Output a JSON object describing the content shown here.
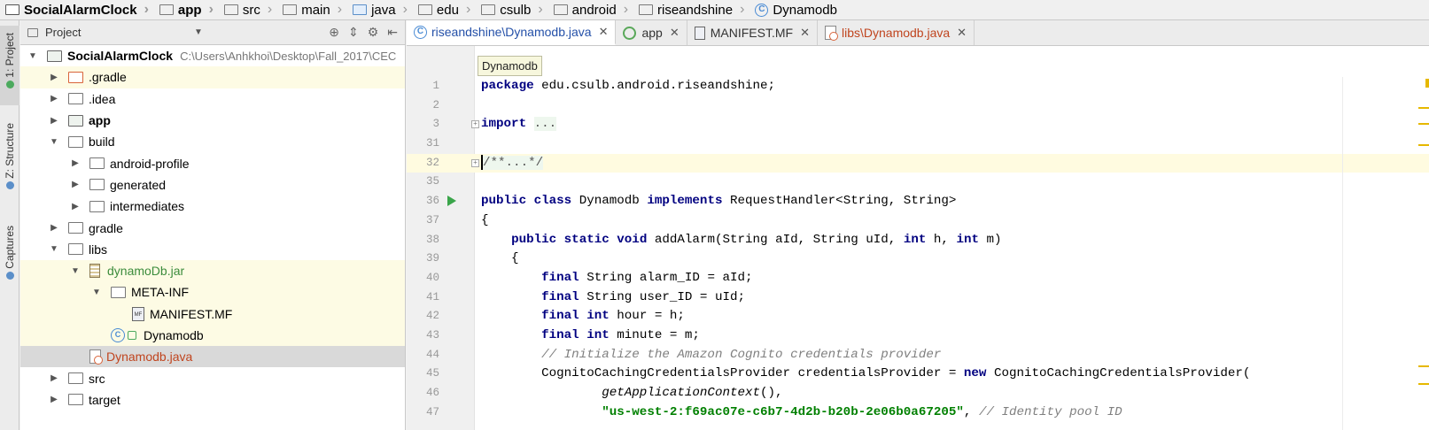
{
  "breadcrumb": [
    {
      "label": "SocialAlarmClock",
      "icon": "project-folder-icon",
      "bold": true
    },
    {
      "label": "app",
      "icon": "module-folder-icon",
      "bold": true
    },
    {
      "label": "src",
      "icon": "folder-icon"
    },
    {
      "label": "main",
      "icon": "folder-icon"
    },
    {
      "label": "java",
      "icon": "source-folder-icon"
    },
    {
      "label": "edu",
      "icon": "package-icon"
    },
    {
      "label": "csulb",
      "icon": "package-icon"
    },
    {
      "label": "android",
      "icon": "package-icon"
    },
    {
      "label": "riseandshine",
      "icon": "package-icon"
    },
    {
      "label": "Dynamodb",
      "icon": "class-icon"
    }
  ],
  "tool_strip": {
    "project": "1: Project",
    "structure": "Z: Structure",
    "captures": "Captures"
  },
  "project_panel": {
    "title": "Project",
    "tree": [
      {
        "label": "SocialAlarmClock",
        "path": "C:\\Users\\Anhkhoi\\Desktop\\Fall_2017\\CEC",
        "depth": 0,
        "state": "open",
        "icon": "project-folder-icon",
        "style": "bold"
      },
      {
        "label": ".gradle",
        "depth": 1,
        "state": "closed",
        "icon": "excluded-folder-icon",
        "highlight": true
      },
      {
        "label": ".idea",
        "depth": 1,
        "state": "closed",
        "icon": "folder-icon"
      },
      {
        "label": "app",
        "depth": 1,
        "state": "closed",
        "icon": "module-folder-icon",
        "style": "bold"
      },
      {
        "label": "build",
        "depth": 1,
        "state": "open",
        "icon": "folder-icon"
      },
      {
        "label": "android-profile",
        "depth": 2,
        "state": "closed",
        "icon": "folder-icon"
      },
      {
        "label": "generated",
        "depth": 2,
        "state": "closed",
        "icon": "folder-icon"
      },
      {
        "label": "intermediates",
        "depth": 2,
        "state": "closed",
        "icon": "folder-icon"
      },
      {
        "label": "gradle",
        "depth": 1,
        "state": "closed",
        "icon": "folder-icon"
      },
      {
        "label": "libs",
        "depth": 1,
        "state": "open",
        "icon": "folder-icon"
      },
      {
        "label": "dynamoDb.jar",
        "depth": 2,
        "state": "open",
        "icon": "jar-icon",
        "style": "green",
        "highlight": true
      },
      {
        "label": "META-INF",
        "depth": 3,
        "state": "open",
        "icon": "meta-folder-icon",
        "highlight": true
      },
      {
        "label": "MANIFEST.MF",
        "depth": 4,
        "state": "none",
        "icon": "manifest-file-icon",
        "highlight": true
      },
      {
        "label": "Dynamodb",
        "depth": 3,
        "state": "none",
        "icon": "class-icon",
        "highlight": true
      },
      {
        "label": "Dynamodb.java",
        "depth": 2,
        "state": "none",
        "icon": "java-file-icon",
        "style": "red",
        "selected": true
      },
      {
        "label": "src",
        "depth": 1,
        "state": "closed",
        "icon": "folder-icon"
      },
      {
        "label": "target",
        "depth": 1,
        "state": "closed",
        "icon": "folder-icon"
      }
    ]
  },
  "tabs": [
    {
      "label": "riseandshine\\Dynamodb.java",
      "icon": "class-icon",
      "active": true
    },
    {
      "label": "app",
      "icon": "android-module-icon"
    },
    {
      "label": "MANIFEST.MF",
      "icon": "manifest-file-icon"
    },
    {
      "label": "libs\\Dynamodb.java",
      "icon": "java-file-icon",
      "style": "red"
    }
  ],
  "tooltip": "Dynamodb",
  "code_lines": [
    {
      "num": "1",
      "text": "package edu.csulb.android.riseandshine;"
    },
    {
      "num": "2",
      "text": ""
    },
    {
      "num": "3",
      "text": "import ...",
      "fold": true
    },
    {
      "num": "31",
      "text": ""
    },
    {
      "num": "32",
      "text": "/**...*/",
      "fold": true,
      "current": true
    },
    {
      "num": "35",
      "text": ""
    },
    {
      "num": "36",
      "text": "public class Dynamodb implements RequestHandler<String, String>",
      "run": true
    },
    {
      "num": "37",
      "text": "{"
    },
    {
      "num": "38",
      "text": "    public static void addAlarm(String aId, String uId, int h, int m)"
    },
    {
      "num": "39",
      "text": "    {"
    },
    {
      "num": "40",
      "text": "        final String alarm_ID = aId;"
    },
    {
      "num": "41",
      "text": "        final String user_ID = uId;"
    },
    {
      "num": "42",
      "text": "        final int hour = h;"
    },
    {
      "num": "43",
      "text": "        final int minute = m;"
    },
    {
      "num": "44",
      "text": "        // Initialize the Amazon Cognito credentials provider"
    },
    {
      "num": "45",
      "text": "        CognitoCachingCredentialsProvider credentialsProvider = new CognitoCachingCredentialsProvider("
    },
    {
      "num": "46",
      "text": "                getApplicationContext(),"
    },
    {
      "num": "47",
      "text": "                \"us-west-2:f69ac07e-c6b7-4d2b-b20b-2e06b0a67205\", // Identity pool ID"
    }
  ],
  "colors": {
    "keyword": "#000080",
    "comment": "#808080",
    "string": "#008000",
    "selection": "#d9d9d9",
    "highlight": "#fdfbe4"
  }
}
